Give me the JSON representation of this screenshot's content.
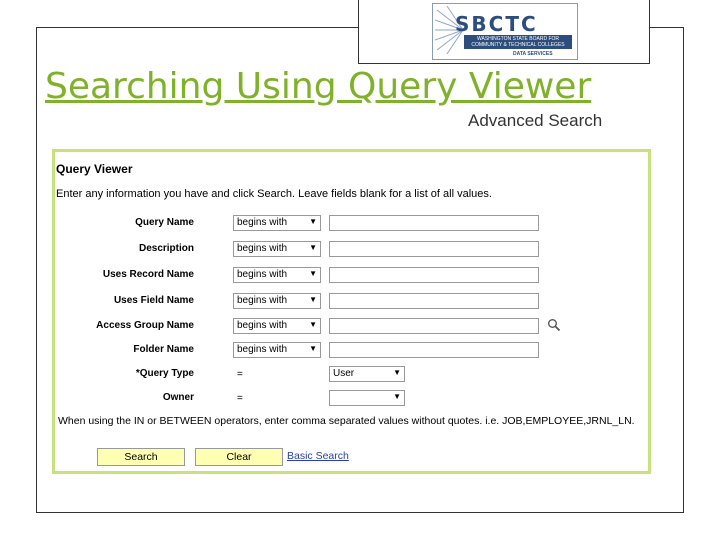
{
  "logo": {
    "name": "SBCTC",
    "subline": "WASHINGTON STATE BOARD FOR COMMUNITY & TECHNICAL COLLEGES",
    "services": "DATA SERVICES"
  },
  "slide": {
    "title": "Searching Using Query Viewer ",
    "subtitle": "Advanced Search"
  },
  "query_viewer": {
    "heading": "Query Viewer",
    "instructions": "Enter any information you have and click Search. Leave fields blank for a list of all values.",
    "fields": [
      {
        "label": "Query Name",
        "operator": "begins with",
        "value": ""
      },
      {
        "label": "Description",
        "operator": "begins with",
        "value": ""
      },
      {
        "label": "Uses Record Name",
        "operator": "begins with",
        "value": ""
      },
      {
        "label": "Uses Field Name",
        "operator": "begins with",
        "value": ""
      },
      {
        "label": "Access Group Name",
        "operator": "begins with",
        "value": ""
      },
      {
        "label": "Folder Name",
        "operator": "begins with",
        "value": ""
      }
    ],
    "query_type": {
      "label": "*Query Type",
      "operator": "=",
      "value": "User"
    },
    "owner": {
      "label": "Owner",
      "operator": "=",
      "value": ""
    },
    "note": "When using the IN or BETWEEN operators, enter comma separated values without quotes. i.e. JOB,EMPLOYEE,JRNL_LN.",
    "search_label": "Search",
    "clear_label": "Clear",
    "basic_search_label": "Basic Search"
  },
  "colors": {
    "title_green": "#7fb12a",
    "panel_border": "#c9e17b",
    "button_fill": "#ffffb3",
    "link_blue": "#2a40a8",
    "logo_blue": "#2d4d7d"
  },
  "icons": {
    "lookup": "magnifier-icon",
    "dropdown": "dropdown-arrow-icon"
  }
}
